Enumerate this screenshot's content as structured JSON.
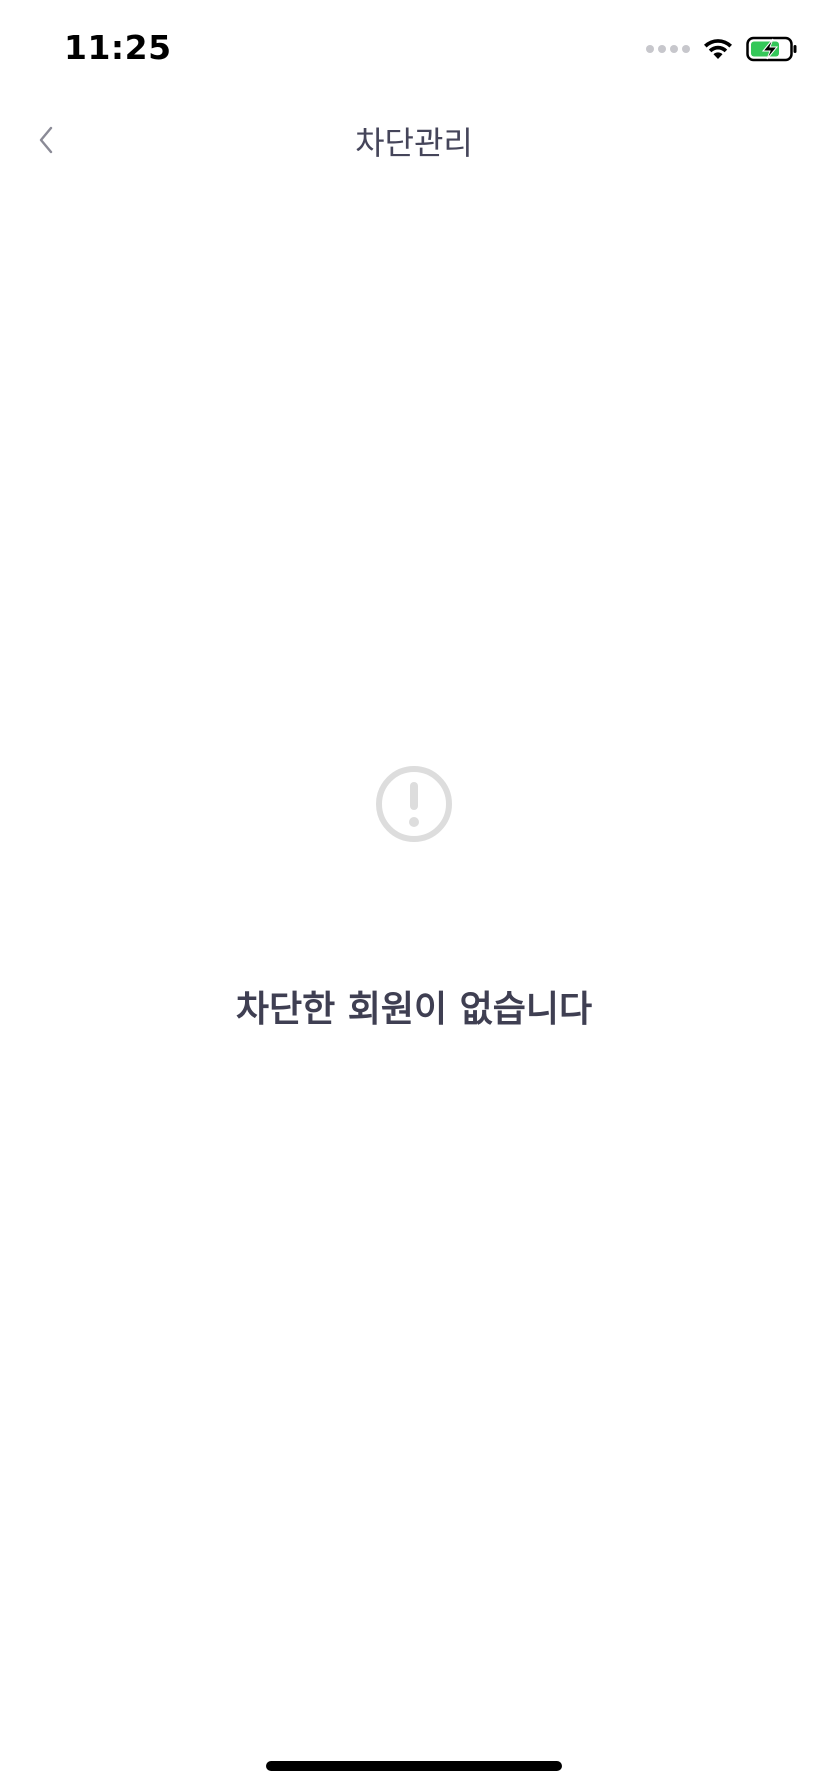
{
  "status_bar": {
    "time": "11:25",
    "icons": [
      "signal-icon",
      "wifi-icon",
      "battery-charging-icon"
    ],
    "battery_color": "#34c759"
  },
  "nav": {
    "back_icon": "chevron-left-icon",
    "title": "차단관리"
  },
  "empty_state": {
    "icon": "exclamation-circle-icon",
    "message": "차단한 회원이 없습니다",
    "icon_color": "#dddddd"
  }
}
